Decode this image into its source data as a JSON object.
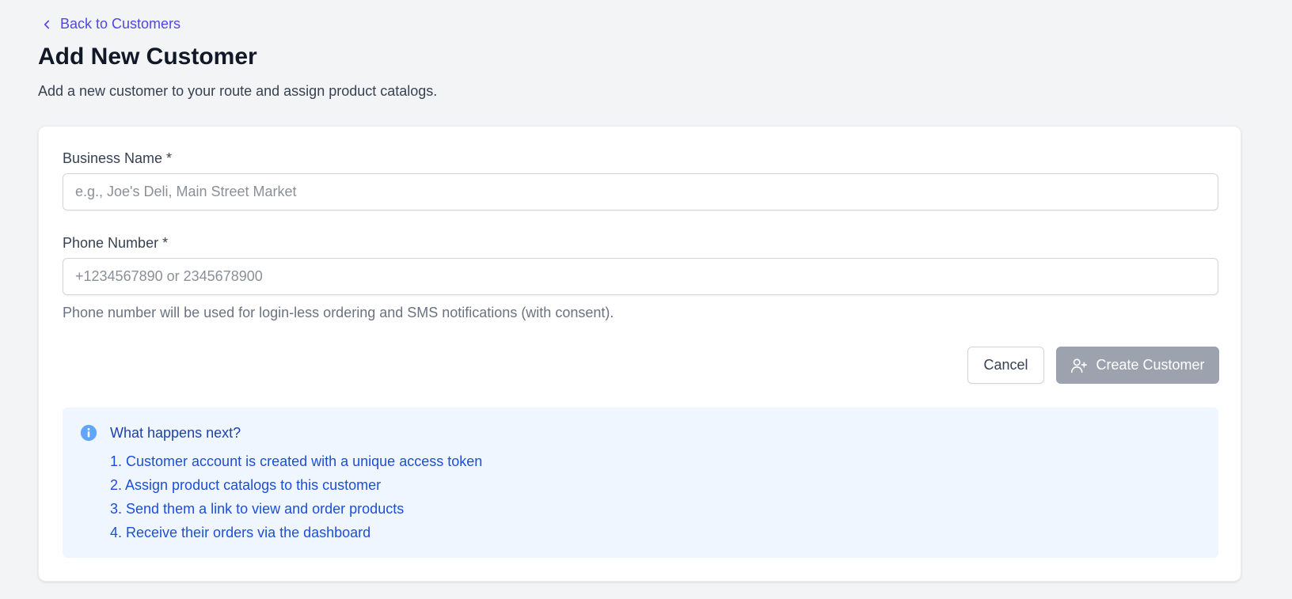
{
  "nav": {
    "back_label": "Back to Customers"
  },
  "header": {
    "title": "Add New Customer",
    "subtitle": "Add a new customer to your route and assign product catalogs."
  },
  "form": {
    "business_name": {
      "label": "Business Name *",
      "value": "",
      "placeholder": "e.g., Joe's Deli, Main Street Market"
    },
    "phone_number": {
      "label": "Phone Number *",
      "value": "",
      "placeholder": "+1234567890 or 2345678900",
      "help": "Phone number will be used for login-less ordering and SMS notifications (with consent)."
    },
    "cancel_label": "Cancel",
    "create_label": "Create Customer",
    "create_icon": "user-plus-icon"
  },
  "info": {
    "icon": "info-icon",
    "title": "What happens next?",
    "steps": [
      "1. Customer account is created with a unique access token",
      "2. Assign product catalogs to this customer",
      "3. Send them a link to view and order products",
      "4. Receive their orders via the dashboard"
    ]
  },
  "colors": {
    "accent": "#4f46e5",
    "page_bg": "#f3f4f6",
    "disabled_button": "#9ca3af",
    "info_bg": "#eff6ff",
    "info_text": "#1d4ed8",
    "info_icon": "#60a5fa"
  }
}
